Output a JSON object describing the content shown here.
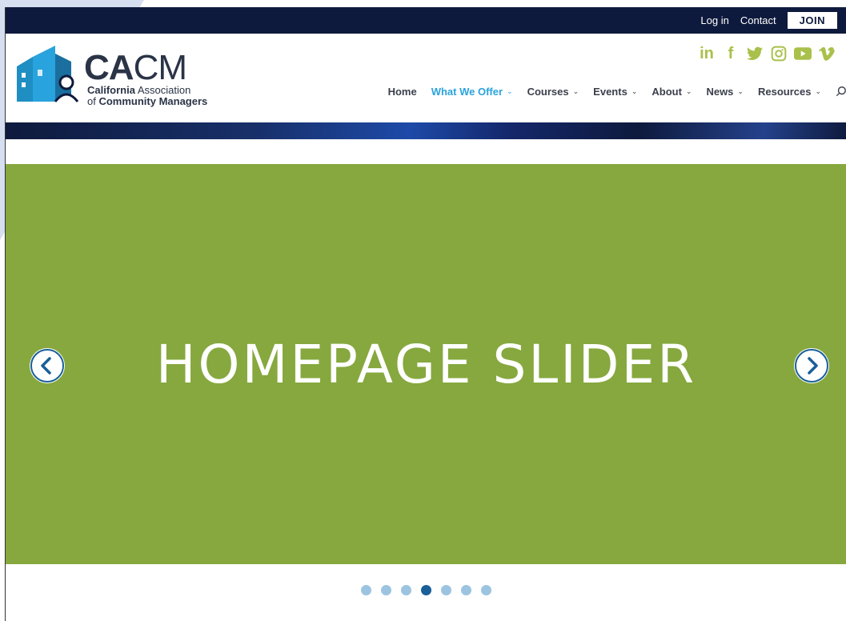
{
  "topbar": {
    "login_label": "Log in",
    "contact_label": "Contact",
    "join_label": "JOIN"
  },
  "logo": {
    "title_bold": "CA",
    "title_thin": "CM",
    "sub1_bold": "California",
    "sub1_rest": " Association",
    "sub2_pre": "of ",
    "sub2_bold": "Community Managers"
  },
  "social": {
    "items": [
      {
        "icon": "linkedin-icon",
        "glyph": "in"
      },
      {
        "icon": "facebook-icon",
        "glyph": "f"
      },
      {
        "icon": "twitter-icon",
        "glyph": "🐦"
      },
      {
        "icon": "instagram-icon",
        "glyph": "◎"
      },
      {
        "icon": "youtube-icon",
        "glyph": "▶"
      },
      {
        "icon": "vimeo-icon",
        "glyph": "v"
      }
    ],
    "color": "#a9c04a"
  },
  "nav": {
    "items": [
      {
        "label": "Home",
        "has_dropdown": false,
        "active": false
      },
      {
        "label": "What We Offer",
        "has_dropdown": true,
        "active": true
      },
      {
        "label": "Courses",
        "has_dropdown": true,
        "active": false
      },
      {
        "label": "Events",
        "has_dropdown": true,
        "active": false
      },
      {
        "label": "About",
        "has_dropdown": true,
        "active": false
      },
      {
        "label": "News",
        "has_dropdown": true,
        "active": false
      },
      {
        "label": "Resources",
        "has_dropdown": true,
        "active": false
      }
    ],
    "active_color": "#29a3dd"
  },
  "slider": {
    "title": "HOMEPAGE SLIDER",
    "background": "#86a83e",
    "total_slides": 7,
    "active_slide": 4
  },
  "colors": {
    "topbar": "#0e1a3d",
    "dot": "#9cc4e0",
    "dot_active": "#1a5f9a"
  }
}
